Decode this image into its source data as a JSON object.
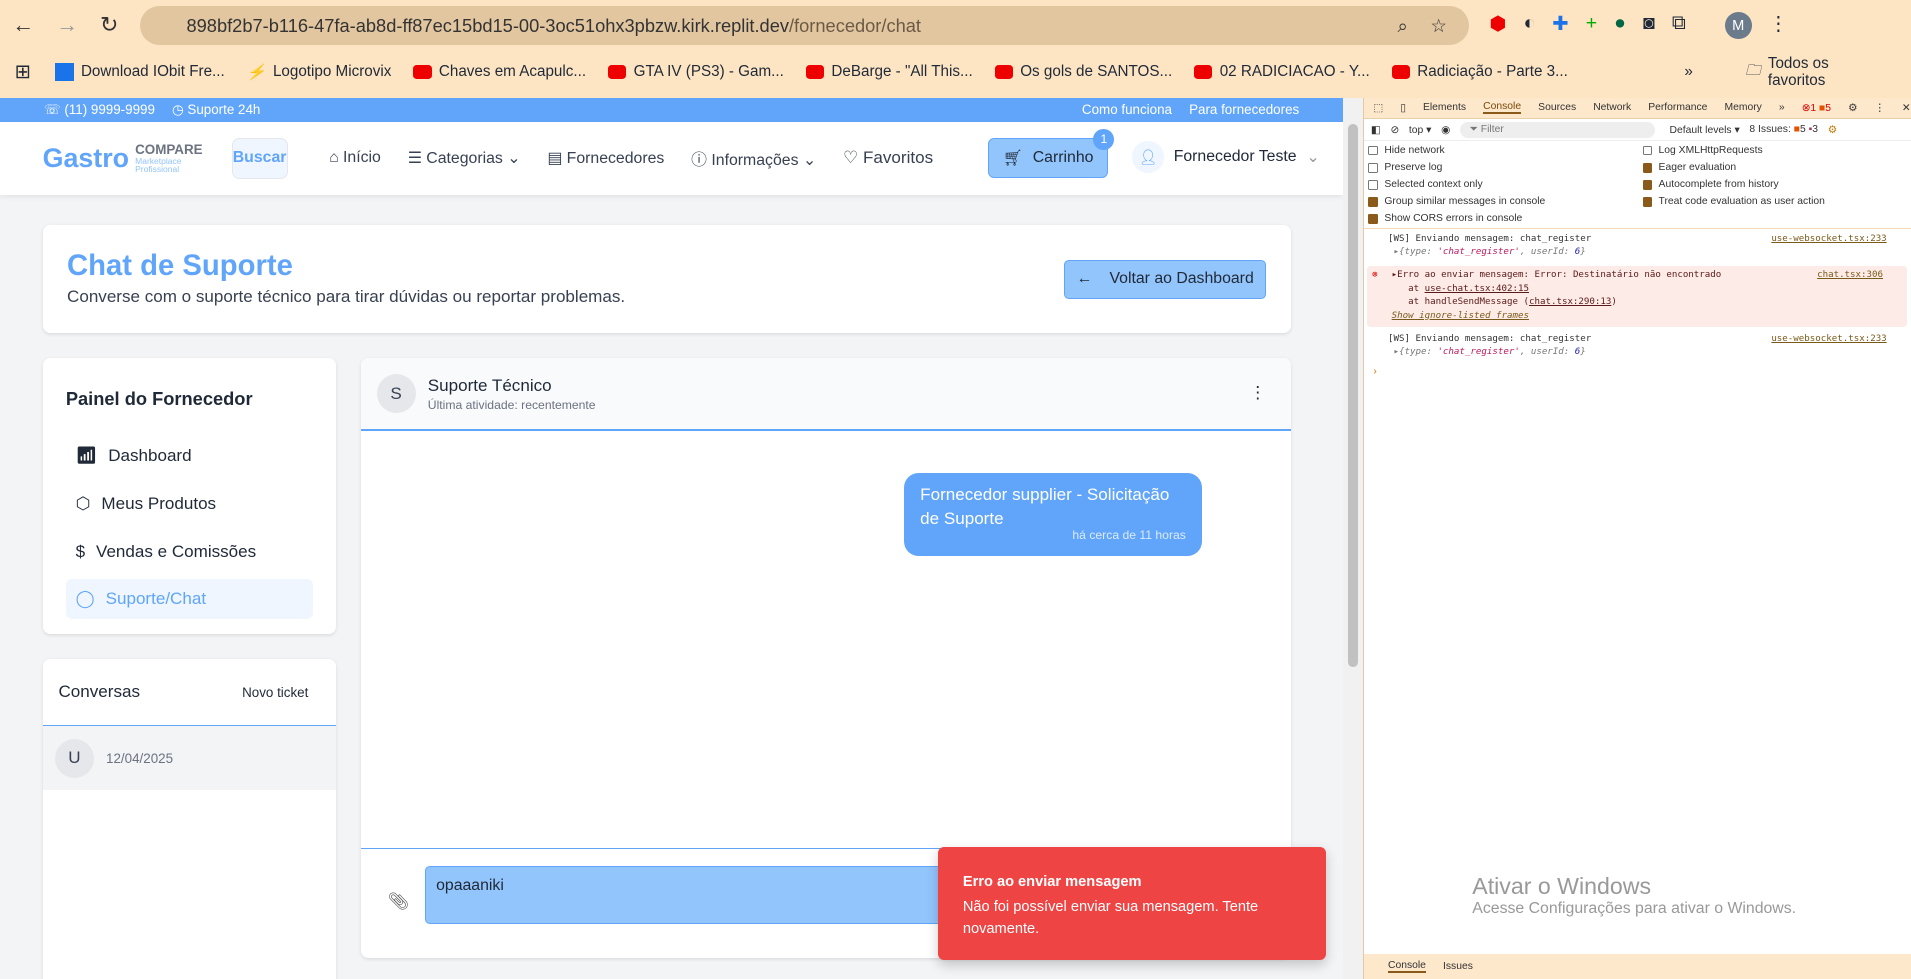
{
  "browser": {
    "url_host": "898bf2b7-b116-47fa-ab8d-ff87ec15bd15-00-3oc51ohx3pbzw.kirk.replit.dev",
    "url_path": "/fornecedor/chat",
    "profile": "M",
    "bookmarks": [
      "Download IObit Fre...",
      "Logotipo Microvix",
      "Chaves em Acapulc...",
      "GTA IV (PS3) - Gam...",
      "DeBarge - \"All This...",
      "Os gols de SANTOS...",
      "02 RADICIACAO - Y...",
      "Radiciação - Parte 3..."
    ],
    "all_bookmarks": "Todos os favoritos"
  },
  "topbar": {
    "phone": "(11) 9999-9999",
    "support": "Suporte 24h",
    "how": "Como funciona",
    "suppliers": "Para fornecedores"
  },
  "header": {
    "logo": "Gastro",
    "logo_compare": "COMPARE",
    "logo_sub1": "Marketplace",
    "logo_sub2": "Profissional",
    "search": "Buscar",
    "nav": [
      "Início",
      "Categorias",
      "Fornecedores",
      "Informações",
      "Favoritos"
    ],
    "cart": "Carrinho",
    "cart_count": "1",
    "user": "Fornecedor Teste"
  },
  "page": {
    "title": "Chat de Suporte",
    "subtitle": "Converse com o suporte técnico para tirar dúvidas ou reportar problemas.",
    "back": "Voltar ao Dashboard"
  },
  "sidebar": {
    "title": "Painel do Fornecedor",
    "items": [
      {
        "label": "Dashboard",
        "icon": "bar-chart-icon"
      },
      {
        "label": "Meus Produtos",
        "icon": "package-icon"
      },
      {
        "label": "Vendas e Comissões",
        "icon": "dollar-icon"
      },
      {
        "label": "Suporte/Chat",
        "icon": "message-icon",
        "active": true
      }
    ]
  },
  "conversations": {
    "title": "Conversas",
    "new": "Novo ticket",
    "items": [
      {
        "avatar": "U",
        "date": "12/04/2025"
      }
    ]
  },
  "chat": {
    "avatar": "S",
    "name": "Suporte Técnico",
    "status": "Última atividade: recentemente",
    "messages": [
      {
        "text": "Fornecedor supplier - Solicitação de Suporte",
        "time": "há cerca de 11 horas"
      }
    ],
    "input": "opaaaniki"
  },
  "toast": {
    "title": "Erro ao enviar mensagem",
    "text": "Não foi possível enviar sua mensagem. Tente novamente.",
    "color": "#ef4444"
  },
  "devtools": {
    "tabs": [
      "Elements",
      "Console",
      "Sources",
      "Network",
      "Performance",
      "Memory"
    ],
    "errors": "1",
    "warnings": "5",
    "context": "top",
    "filter": "Filter",
    "levels": "Default levels",
    "issues": "8 Issues:",
    "issues_warn": "5",
    "issues_info": "3",
    "options": [
      {
        "label": "Hide network",
        "on": false
      },
      {
        "label": "Log XMLHttpRequests",
        "on": false
      },
      {
        "label": "Preserve log",
        "on": false
      },
      {
        "label": "Eager evaluation",
        "on": true
      },
      {
        "label": "Selected context only",
        "on": false
      },
      {
        "label": "Autocomplete from history",
        "on": true
      },
      {
        "label": "Group similar messages in console",
        "on": true
      },
      {
        "label": "Treat code evaluation as user action",
        "on": true
      },
      {
        "label": "Show CORS errors in console",
        "on": true
      }
    ],
    "log1": "[WS] Enviando mensagem: chat_register",
    "log1_src": "use-websocket.tsx:233",
    "err": "Erro ao enviar mensagem: Error: Destinatário não encontrado",
    "err_src": "chat.tsx:306",
    "err_at1": "use-chat.tsx:402:15",
    "err_at2": "chat.tsx:290:13",
    "err_show": "Show ignore-listed frames",
    "log2": "[WS] Enviando mensagem: chat_register",
    "log2_src": "use-websocket.tsx:233",
    "footer_tabs": [
      "Console",
      "Issues"
    ]
  },
  "windows": {
    "title": "Ativar o Windows",
    "text": "Acesse Configurações para ativar o Windows."
  },
  "colors": {
    "accent": "#60a5fa",
    "error": "#ef4444"
  }
}
